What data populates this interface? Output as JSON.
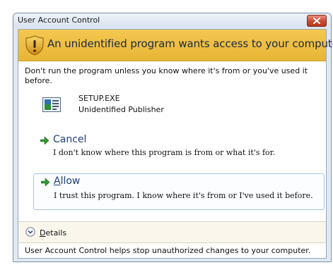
{
  "window": {
    "title": "User Account Control",
    "close_icon": "close-icon"
  },
  "banner": {
    "icon": "shield-warning-icon",
    "text": "An unidentified program wants access to your computer",
    "color": "#f0c04a"
  },
  "warning_text": "Don't run the program unless you know where it's from or you've used it before.",
  "program": {
    "icon": "program-icon",
    "name": "SETUP.EXE",
    "publisher": "Unidentified Publisher"
  },
  "options": {
    "cancel": {
      "icon": "green-arrow-icon",
      "title": "Cancel",
      "description": "I don't know where this program is from or what it's for."
    },
    "allow": {
      "icon": "green-arrow-icon",
      "title_accel": "A",
      "title_rest": "llow",
      "description": "I trust this program. I know where it's from or I've used it before."
    }
  },
  "details": {
    "icon": "chevron-down-circle-icon",
    "label_accel": "D",
    "label_rest": "etails"
  },
  "footer_text": "User Account Control helps stop unauthorized changes to your computer."
}
